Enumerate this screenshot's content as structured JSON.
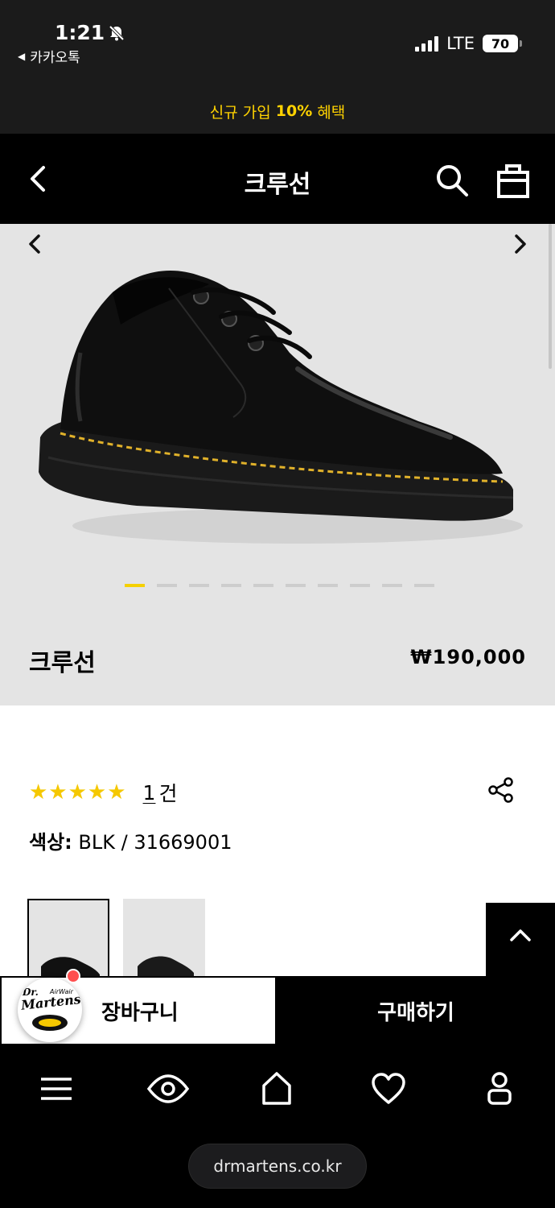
{
  "status_bar": {
    "time": "1:21",
    "back_app": "카카오톡",
    "network": "LTE",
    "battery": "70"
  },
  "promo": {
    "prefix": "신규 가입",
    "highlight": "10%",
    "suffix": "혜택"
  },
  "header": {
    "title": "크루선"
  },
  "gallery": {
    "total_images": 10,
    "active_index": 0
  },
  "product": {
    "name": "크루선",
    "price": "₩190,000",
    "stars": "★★★★★",
    "review_count": "1",
    "review_unit": "건",
    "color_label": "색상:",
    "color_value": "BLK / 31669001"
  },
  "actions": {
    "cart": "장바구니",
    "buy": "구매하기"
  },
  "logo": {
    "brand_line1": "Dr.",
    "brand_line2": "Martens",
    "brand_line3": "AirWair"
  },
  "tabbar": {
    "icons": [
      "menu-icon",
      "eye-icon",
      "home-icon",
      "heart-icon",
      "user-icon"
    ]
  },
  "browser": {
    "url": "drmartens.co.kr"
  },
  "colors": {
    "promo_yellow": "#ffd200",
    "star_yellow": "#f5c800",
    "active_dot": "#f5d000",
    "stitch": "#e0b12a"
  }
}
